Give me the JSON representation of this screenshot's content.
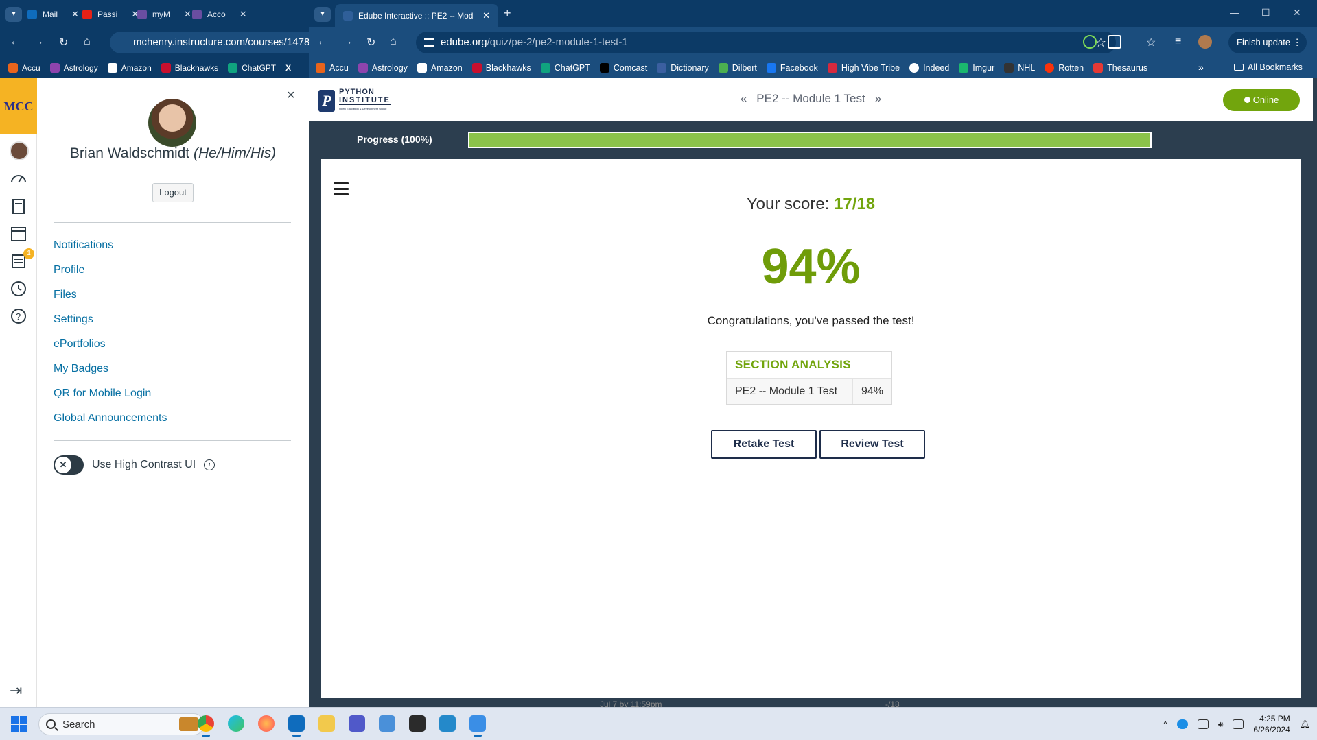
{
  "left_window": {
    "tabs": [
      {
        "label": "Mail"
      },
      {
        "label": "Passi"
      },
      {
        "label": "myM"
      },
      {
        "label": "Acco"
      }
    ],
    "url": "mchenry.instructure.com/courses/147844",
    "bookmarks": [
      "Accu",
      "Astrology",
      "Amazon",
      "Blackhawks",
      "ChatGPT",
      "X"
    ]
  },
  "canvas": {
    "logo_text": "MCC",
    "badge_count": "1",
    "user_name": "Brian Waldschmidt",
    "pronouns": "(He/Him/His)",
    "logout_label": "Logout",
    "close_label": "×",
    "links": [
      "Notifications",
      "Profile",
      "Files",
      "Settings",
      "ePortfolios",
      "My Badges",
      "QR for Mobile Login",
      "Global Announcements"
    ],
    "high_contrast_label": "Use High Contrast UI"
  },
  "right_window": {
    "active_tab_title": "Edube Interactive :: PE2 -- Mod",
    "url_domain": "edube.org",
    "url_path": "/quiz/pe-2/pe2-module-1-test-1",
    "finish_update_label": "Finish update",
    "bookmarks": [
      "Accu",
      "Astrology",
      "Amazon",
      "Blackhawks",
      "ChatGPT",
      "Comcast",
      "Dictionary",
      "Dilbert",
      "Facebook",
      "High Vibe Tribe",
      "Indeed",
      "Imgur",
      "NHL",
      "Rotten",
      "Thesaurus"
    ],
    "all_bookmarks_label": "All Bookmarks"
  },
  "quiz": {
    "logo_line1": "PYTHON",
    "logo_line2": "INSTITUTE",
    "logo_line3": "Open Education & Development Group",
    "title": "PE2 -- Module 1 Test",
    "online_label": "Online",
    "progress_label": "Progress (100%)",
    "progress_fraction": 1.0,
    "score_label": "Your score:",
    "score_value": "17/18",
    "percent": "94%",
    "congrats": "Congratulations, you've passed the test!",
    "section_header": "SECTION ANALYSIS",
    "section_row": {
      "name": "PE2 -- Module 1 Test",
      "pct": "94%"
    },
    "retake_label": "Retake Test",
    "review_label": "Review Test"
  },
  "background_text": {
    "due": "Jul 7 by 11:59pm",
    "score": "-/18"
  },
  "taskbar": {
    "search_placeholder": "Search",
    "time": "4:25 PM",
    "date": "6/26/2024"
  },
  "colors": {
    "accent_green": "#72a50d",
    "chrome_blue": "#0c3a66",
    "canvas_link": "#0770a3",
    "page_bg": "#2c3e4f"
  }
}
